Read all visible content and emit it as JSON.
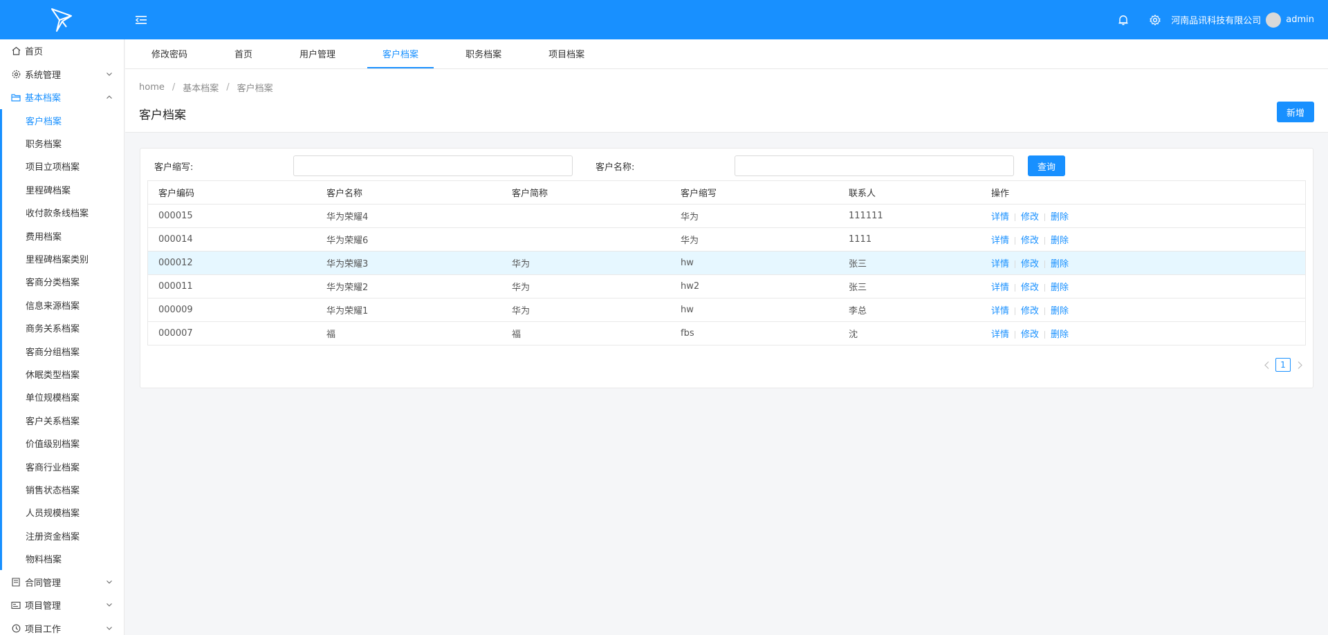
{
  "header": {
    "company": "河南品讯科技有限公司",
    "username": "admin"
  },
  "sidebar": {
    "top_items": [
      {
        "label": "首页",
        "icon": "home-icon"
      },
      {
        "label": "系统管理",
        "icon": "gear-icon"
      },
      {
        "label": "基本档案",
        "icon": "folder-icon"
      }
    ],
    "sub_items": [
      "客户档案",
      "职务档案",
      "项目立项档案",
      "里程碑档案",
      "收付款条线档案",
      "费用档案",
      "里程碑档案类别",
      "客商分类档案",
      "信息来源档案",
      "商务关系档案",
      "客商分组档案",
      "休眠类型档案",
      "单位规模档案",
      "客户关系档案",
      "价值级别档案",
      "客商行业档案",
      "销售状态档案",
      "人员规模档案",
      "注册资金档案",
      "物料档案"
    ],
    "bottom_items": [
      {
        "label": "合同管理",
        "icon": "contract-icon"
      },
      {
        "label": "项目管理",
        "icon": "project-icon"
      },
      {
        "label": "项目工作",
        "icon": "clock-icon"
      }
    ]
  },
  "tabs": [
    "修改密码",
    "首页",
    "用户管理",
    "客户档案",
    "职务档案",
    "项目档案"
  ],
  "breadcrumb": [
    "home",
    "基本档案",
    "客户档案"
  ],
  "page": {
    "title": "客户档案",
    "new_button": "新增"
  },
  "search": {
    "abbr_label": "客户缩写:",
    "abbr_value": "",
    "name_label": "客户名称:",
    "name_value": "",
    "query_button": "查询"
  },
  "table": {
    "columns": [
      "客户编码",
      "客户名称",
      "客户简称",
      "客户缩写",
      "联系人",
      "操作"
    ],
    "rows": [
      [
        "000015",
        "华为荣耀4",
        "",
        "华为",
        "111111"
      ],
      [
        "000014",
        "华为荣耀6",
        "",
        "华为",
        "1111"
      ],
      [
        "000012",
        "华为荣耀3",
        "华为",
        "hw",
        "张三"
      ],
      [
        "000011",
        "华为荣耀2",
        "华为",
        "hw2",
        "张三"
      ],
      [
        "000009",
        "华为荣耀1",
        "华为",
        "hw",
        "李总"
      ],
      [
        "000007",
        "福",
        "福",
        "fbs",
        "沈"
      ]
    ],
    "actions": [
      "详情",
      "修改",
      "删除"
    ]
  },
  "pagination": {
    "current": "1"
  },
  "colors": {
    "primary": "#1890ff",
    "row_highlight": "#e6f7ff"
  }
}
